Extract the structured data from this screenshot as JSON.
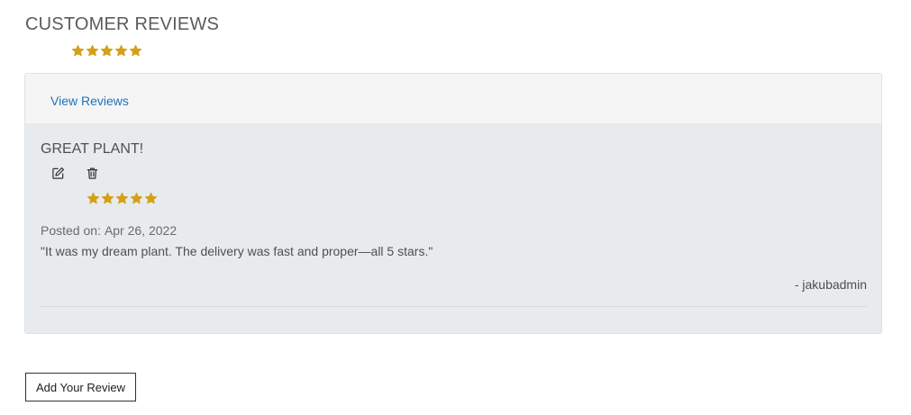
{
  "section": {
    "title": "CUSTOMER REVIEWS",
    "average_rating": 5,
    "max_rating": 5
  },
  "card": {
    "header_link": "View Reviews"
  },
  "review": {
    "title": "GREAT PLANT!",
    "rating": 5,
    "posted_label": "Posted on:",
    "posted_date": "Apr 26, 2022",
    "text": "\"It was my dream plant. The delivery was fast and proper—all 5 stars.\"",
    "author": "- jakubadmin",
    "icons": {
      "edit": "edit-icon",
      "delete": "trash-icon",
      "star": "star-icon"
    }
  },
  "actions": {
    "add_review_label": "Add Your Review"
  },
  "colors": {
    "star": "#d4a017",
    "link": "#1f73b7",
    "card_bg": "#e8ebee",
    "header_bg": "#f5f5f6"
  }
}
